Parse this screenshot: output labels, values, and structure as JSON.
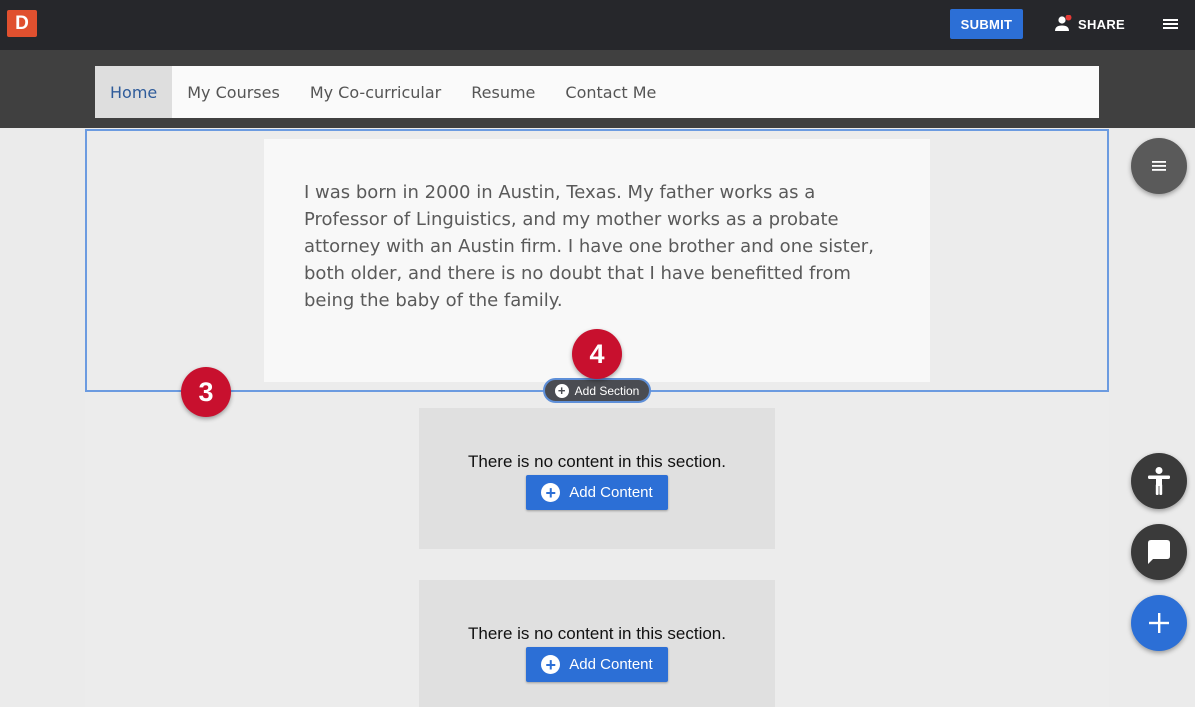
{
  "topbar": {
    "logo_letter": "D",
    "submit_label": "SUBMIT",
    "share_label": "SHARE"
  },
  "nav": {
    "items": [
      {
        "label": "Home",
        "active": true
      },
      {
        "label": "My Courses"
      },
      {
        "label": "My Co-curricular"
      },
      {
        "label": "Resume"
      },
      {
        "label": "Contact Me"
      }
    ]
  },
  "main": {
    "bio_text": "I was born in 2000 in Austin, Texas. My father works as a Professor of Linguistics, and my mother works as a probate attorney with an Austin firm. I have one brother and one sister, both older, and there is no doubt that I have benefitted from being the baby of the family.",
    "add_section_label": "Add Section",
    "empty_sections": [
      {
        "text": "There is no content in this section.",
        "button_label": "Add Content"
      },
      {
        "text": "There is no content in this section.",
        "button_label": "Add Content"
      }
    ]
  },
  "annotations": {
    "badge_3": "3",
    "badge_4": "4"
  },
  "colors": {
    "topbar": "#26272b",
    "brand": "#e0502f",
    "accent": "#2c6fd6",
    "badge": "#c8102e"
  },
  "icons": [
    "hamburger-menu-icon",
    "user-icon",
    "notification-dot",
    "list-menu-icon",
    "accessibility-icon",
    "chat-icon",
    "plus-icon"
  ]
}
